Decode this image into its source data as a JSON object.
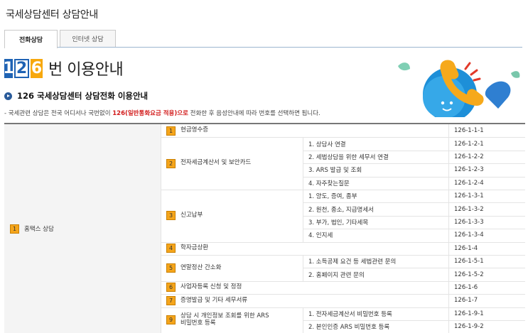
{
  "page": {
    "title": "국세상담센터 상담안내"
  },
  "tabs": [
    {
      "label": "전화상담",
      "active": true
    },
    {
      "label": "인터넷 상담",
      "active": false
    }
  ],
  "brand": {
    "digits": [
      "1",
      "2",
      "6"
    ],
    "text": "번 이용안내"
  },
  "section": {
    "title": "126 국세상담센터 상담전화 이용안내"
  },
  "note": {
    "prefix": "- 국세관련 상담은 전국 어디서나 국번없이 ",
    "highlight": "126(일반통화요금 적용)으로",
    "suffix": " 전화한 후 음성안내에 따라 번호를 선택하면 됩니다."
  },
  "colors": {
    "accent": "#1f63b4",
    "number_badge": "#f5a51b",
    "highlight": "#d21b1b"
  },
  "table": {
    "category": {
      "num": "1",
      "label": "홈택스 상담"
    },
    "groups": [
      {
        "num": "1",
        "label": "현금영수증",
        "code": "126-1-1-1",
        "items": []
      },
      {
        "num": "2",
        "label": "전자세금계산서 및 보안카드",
        "items": [
          {
            "label": "1. 상담사 연결",
            "code": "126-1-2-1"
          },
          {
            "label": "2. 세법상담을 위한 세무서 연결",
            "code": "126-1-2-2"
          },
          {
            "label": "3. ARS 발급 및 조회",
            "code": "126-1-2-3"
          },
          {
            "label": "4. 자주찾는질문",
            "code": "126-1-2-4"
          }
        ]
      },
      {
        "num": "3",
        "label": "신고납부",
        "items": [
          {
            "label": "1. 양도, 증여, 종부",
            "code": "126-1-3-1"
          },
          {
            "label": "2. 원천, 종소, 지급명세서",
            "code": "126-1-3-2"
          },
          {
            "label": "3. 부가, 법인, 기타세목",
            "code": "126-1-3-3"
          },
          {
            "label": "4. 인지세",
            "code": "126-1-3-4"
          }
        ]
      },
      {
        "num": "4",
        "label": "학자금상환",
        "code": "126-1-4",
        "items": []
      },
      {
        "num": "5",
        "label": "연말정산 간소화",
        "items": [
          {
            "label": "1. 소득공제 요건 등 세법관련 문의",
            "code": "126-1-5-1"
          },
          {
            "label": "2. 홈페이지 관련 문의",
            "code": "126-1-5-2"
          }
        ]
      },
      {
        "num": "6",
        "label": "사업자등록 신청 및 정정",
        "code": "126-1-6",
        "items": []
      },
      {
        "num": "7",
        "label": "증명발급 및 기타 세무서류",
        "code": "126-1-7",
        "items": []
      },
      {
        "num": "9",
        "label": "상담 시 개인정보 조회를 위한 ARS 비밀번호 등록",
        "items": [
          {
            "label": "1. 전자세금계산서 비밀번호 등록",
            "code": "126-1-9-1"
          },
          {
            "label": "2. 본인인증 ARS 비밀번호 등록",
            "code": "126-1-9-2"
          }
        ]
      }
    ]
  }
}
